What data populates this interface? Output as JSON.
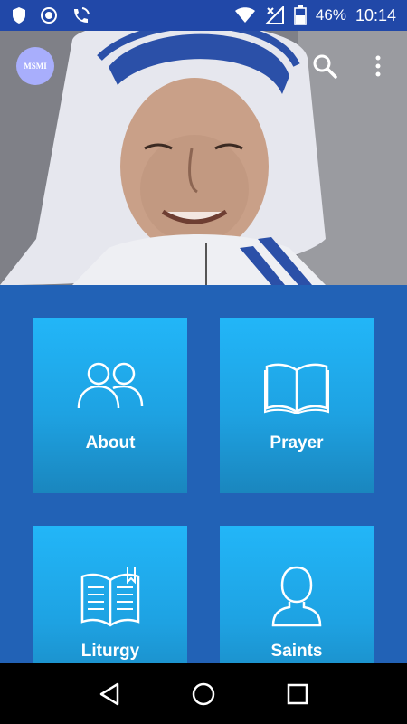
{
  "status_bar": {
    "battery": "46%",
    "time": "10:14",
    "icons": [
      "shield-icon",
      "record-icon",
      "wifi-call-icon",
      "wifi-icon",
      "no-signal-icon",
      "battery-icon"
    ]
  },
  "header": {
    "logo_text": "MSMI",
    "actions": [
      "search-icon",
      "more-vert-icon"
    ]
  },
  "tiles": [
    {
      "label": "About",
      "icon": "people-icon"
    },
    {
      "label": "Prayer",
      "icon": "book-open-icon"
    },
    {
      "label": "Liturgy",
      "icon": "bible-icon"
    },
    {
      "label": "Saints",
      "icon": "person-icon"
    }
  ],
  "nav": [
    "back-icon",
    "home-icon",
    "recents-icon"
  ],
  "colors": {
    "status_bar": "#2148a8",
    "background": "#2262b6",
    "tile_top": "#22b6f8",
    "tile_bottom": "#1a86be",
    "nav_bar": "#000000"
  }
}
